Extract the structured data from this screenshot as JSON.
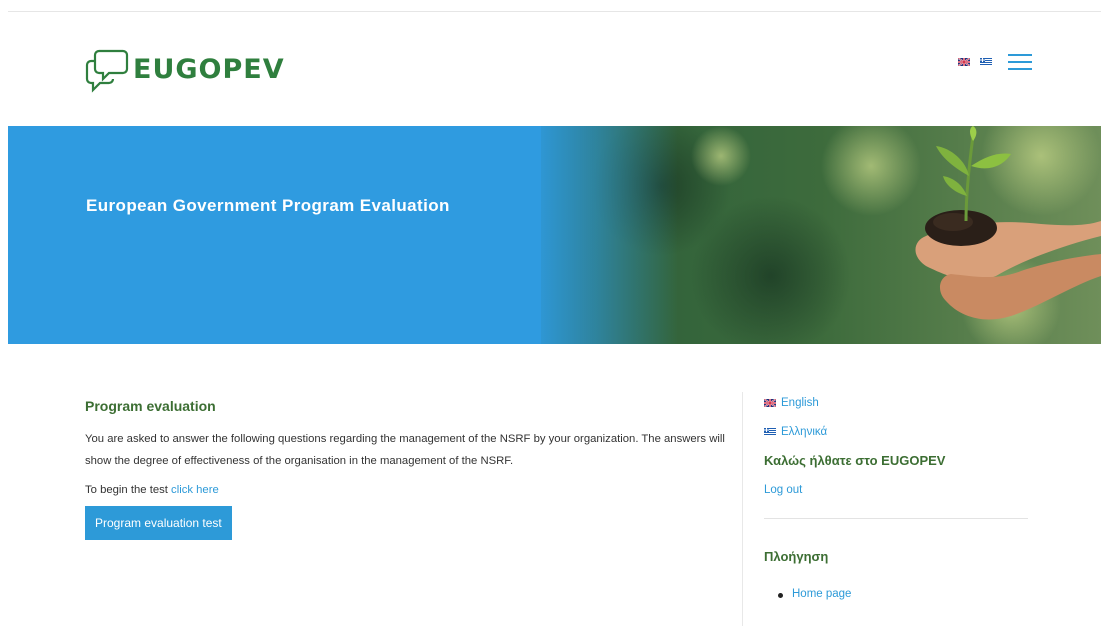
{
  "header": {
    "logo_text": "EUGOPEV",
    "menu_icon": "hamburger-icon",
    "flag_icons": [
      "uk-flag-icon",
      "greece-flag-icon"
    ]
  },
  "hero": {
    "title": "European Government Program Evaluation"
  },
  "main": {
    "heading": "Program evaluation",
    "paragraph": "You are asked to answer the following questions regarding the management of the NSRF by your organization. The answers will show the degree of effectiveness of the organisation in the management of the NSRF.",
    "begin_prefix": "To begin the test",
    "begin_link": "click here",
    "button_label": "Program evaluation test"
  },
  "sidebar": {
    "languages": [
      {
        "label": "English"
      },
      {
        "label": "Ελληνικά"
      }
    ],
    "welcome": "Καλώς ήλθατε στο EUGOPEV",
    "logout": "Log out",
    "nav_heading": "Πλοήγηση",
    "nav_items": [
      {
        "label": "Home page"
      }
    ]
  },
  "colors": {
    "brand_green": "#2f7f3e",
    "accent_blue": "#2d9ad8",
    "heading_green": "#3c6e33",
    "hero_blue": "#2f9be0"
  }
}
